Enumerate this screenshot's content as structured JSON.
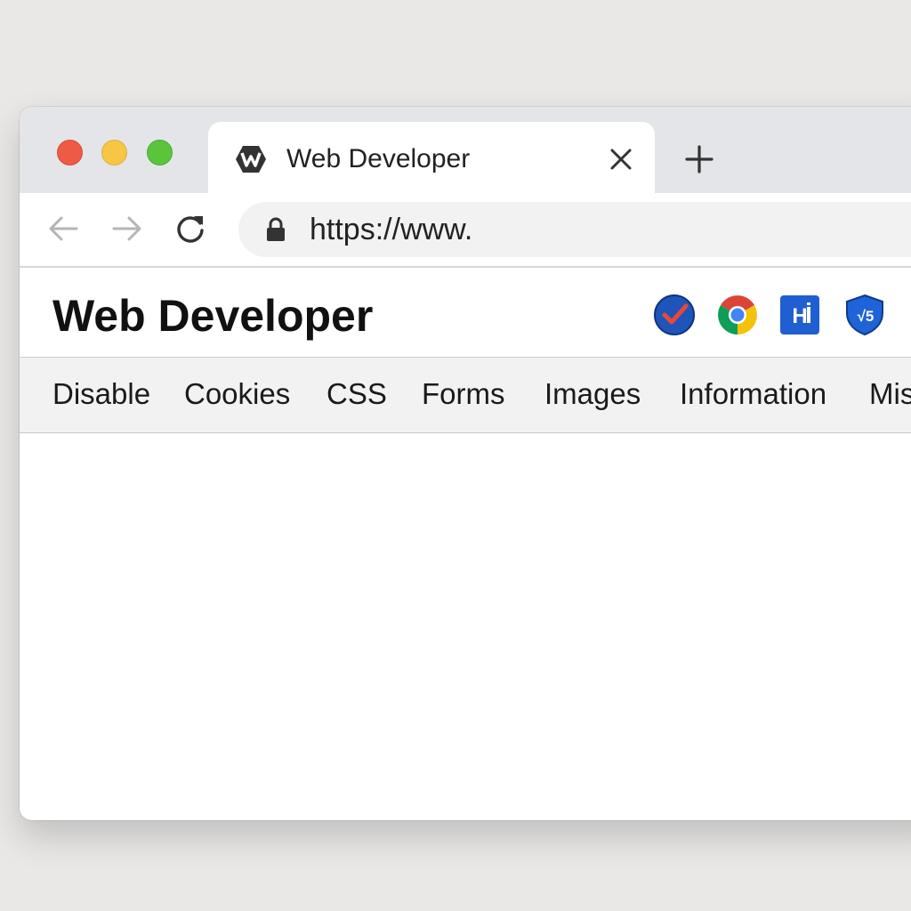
{
  "window": {
    "traffic_lights": [
      "close",
      "minimize",
      "zoom"
    ]
  },
  "tab": {
    "title": "Web Developer",
    "icon": "web-developer-logo-icon",
    "close_icon": "close-icon"
  },
  "new_tab_icon": "plus-icon",
  "toolbar": {
    "back_icon": "arrow-left-icon",
    "forward_icon": "arrow-right-icon",
    "reload_icon": "reload-icon",
    "lock_icon": "lock-icon",
    "url": "https://www."
  },
  "extension": {
    "title": "Web Developer",
    "icons": [
      "check-badge-icon",
      "chrome-icon",
      "html-validator-icon",
      "shield-v5-icon"
    ]
  },
  "menu": {
    "items": [
      "Disable",
      "Cookies",
      "CSS",
      "Forms",
      "Images",
      "Information",
      "Mis"
    ]
  },
  "colors": {
    "close": "#ee5a45",
    "minimize": "#f6c644",
    "zoom": "#5ac43d",
    "accent_blue": "#1f5fd1"
  }
}
